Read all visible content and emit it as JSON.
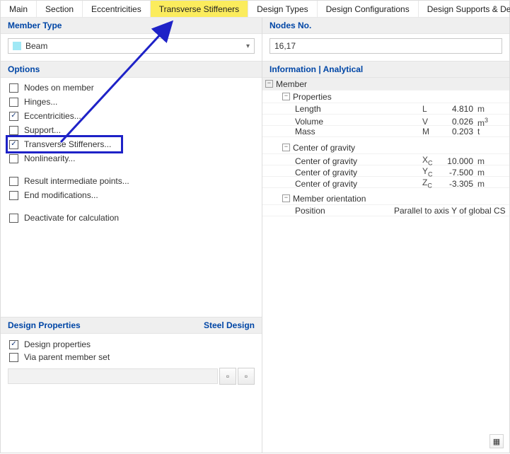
{
  "tabs": {
    "items": [
      {
        "label": "Main"
      },
      {
        "label": "Section"
      },
      {
        "label": "Eccentricities"
      },
      {
        "label": "Transverse Stiffeners"
      },
      {
        "label": "Design Types"
      },
      {
        "label": "Design Configurations"
      },
      {
        "label": "Design Supports & Deflection"
      }
    ]
  },
  "left": {
    "memberType": {
      "header": "Member Type",
      "selected": "Beam"
    },
    "options": {
      "header": "Options",
      "items": [
        {
          "label": "Nodes on member",
          "checked": false
        },
        {
          "label": "Hinges...",
          "checked": false
        },
        {
          "label": "Eccentricities...",
          "checked": true
        },
        {
          "label": "Support...",
          "checked": false
        },
        {
          "label": "Transverse Stiffeners...",
          "checked": true
        },
        {
          "label": "Nonlinearity...",
          "checked": false
        },
        {
          "label": "Result intermediate points...",
          "checked": false
        },
        {
          "label": "End modifications...",
          "checked": false
        },
        {
          "label": "Deactivate for calculation",
          "checked": false
        }
      ]
    },
    "designProps": {
      "header": "Design Properties",
      "rightLabel": "Steel Design",
      "items": [
        {
          "label": "Design properties",
          "checked": true
        },
        {
          "label": "Via parent member set",
          "checked": false
        }
      ]
    }
  },
  "right": {
    "nodes": {
      "header": "Nodes No.",
      "value": "16,17"
    },
    "info": {
      "header": "Information | Analytical",
      "memberLabel": "Member",
      "groups": {
        "properties": {
          "label": "Properties",
          "rows": [
            {
              "name": "Length",
              "sym": "L",
              "val": "4.810",
              "unit": "m"
            },
            {
              "name": "Volume",
              "sym": "V",
              "val": "0.026",
              "unit_html": "m3_sup"
            },
            {
              "name": "Mass",
              "sym": "M",
              "val": "0.203",
              "unit": "t"
            }
          ]
        },
        "cog": {
          "label": "Center of gravity",
          "rows": [
            {
              "name": "Center of gravity",
              "sym_html": "XC",
              "val": "10.000",
              "unit": "m"
            },
            {
              "name": "Center of gravity",
              "sym_html": "YC",
              "val": "-7.500",
              "unit": "m"
            },
            {
              "name": "Center of gravity",
              "sym_html": "ZC",
              "val": "-3.305",
              "unit": "m"
            }
          ]
        },
        "orientation": {
          "label": "Member orientation",
          "position_label": "Position",
          "position_value": "Parallel to axis Y of global CS"
        }
      }
    }
  }
}
